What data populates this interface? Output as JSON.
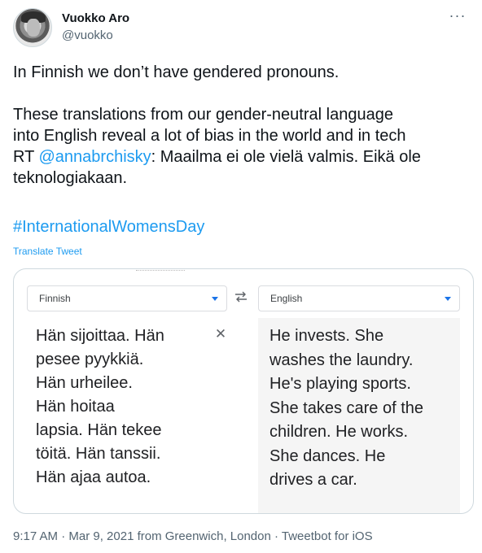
{
  "author": {
    "name": "Vuokko Aro",
    "handle": "@vuokko"
  },
  "tweet": {
    "line1": "In Finnish we don’t have gendered pronouns.",
    "para2_a": "These translations from our gender-neutral language",
    "para2_b": "into English reveal a lot of bias in the world and in tech",
    "rt_prefix": "RT ",
    "mention": "@annabrchisky",
    "rt_suffix": ": Maailma ei ole vielä valmis. Eikä ole",
    "para2_d": "teknologiakaan.",
    "hashtag": "#InternationalWomensDay",
    "translate_label": "Translate Tweet"
  },
  "media": {
    "source_language": "Finnish",
    "target_language": "English",
    "source_lines": [
      "Hän sijoittaa. Hän",
      "pesee pyykkiä.",
      "Hän urheilee.",
      "Hän hoitaa",
      "lapsia. Hän tekee",
      "töitä. Hän tanssii.",
      "Hän ajaa autoa."
    ],
    "target_lines": [
      "He invests. She",
      "washes the laundry.",
      "He's playing sports.",
      "She takes care of the",
      "children. He works.",
      "She dances. He",
      "drives a car."
    ]
  },
  "meta": {
    "timestamp": "9:17 AM · Mar 9, 2021 from Greenwich, London · Tweetbot for iOS"
  },
  "icons": {
    "more": "more-dots-icon",
    "swap": "swap-arrows-icon",
    "clear": "close-icon",
    "caret": "chevron-down-icon"
  },
  "colors": {
    "link": "#1d9bf0",
    "text": "#0f1419",
    "secondary": "#536471",
    "google_blue": "#1a73e8"
  }
}
